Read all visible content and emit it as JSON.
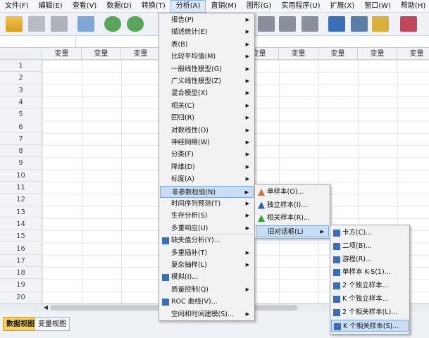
{
  "menubar": [
    "文件(F)",
    "编辑(E)",
    "查看(V)",
    "数据(D)",
    "转换(T)",
    "分析(A)",
    "直销(M)",
    "图形(G)",
    "实用程序(U)",
    "扩展(X)",
    "窗口(W)",
    "帮助(H)"
  ],
  "active_menu_index": 5,
  "grid": {
    "col_header": "变量",
    "rows": [
      "1",
      "2",
      "3",
      "4",
      "5",
      "6",
      "7",
      "8",
      "9",
      "10",
      "11",
      "12",
      "13",
      "14",
      "15",
      "16",
      "17",
      "18",
      "19",
      "20",
      "21"
    ]
  },
  "analyze_menu": [
    {
      "label": "报告(P)",
      "arrow": true
    },
    {
      "label": "描述统计(E)",
      "arrow": true
    },
    {
      "label": "表(B)",
      "arrow": true
    },
    {
      "label": "比较平均值(M)",
      "arrow": true
    },
    {
      "label": "一般线性模型(G)",
      "arrow": true
    },
    {
      "label": "广义线性模型(Z)",
      "arrow": true
    },
    {
      "label": "混合模型(X)",
      "arrow": true
    },
    {
      "label": "相关(C)",
      "arrow": true
    },
    {
      "label": "回归(R)",
      "arrow": true
    },
    {
      "label": "对数线性(O)",
      "arrow": true
    },
    {
      "label": "神经网络(W)",
      "arrow": true
    },
    {
      "label": "分类(F)",
      "arrow": true
    },
    {
      "label": "降维(D)",
      "arrow": true
    },
    {
      "label": "标度(A)",
      "arrow": true
    },
    {
      "label": "非参数检验(N)",
      "arrow": true,
      "highlight": true
    },
    {
      "label": "时间序列预测(T)",
      "arrow": true
    },
    {
      "label": "生存分析(S)",
      "arrow": true
    },
    {
      "label": "多重响应(U)",
      "arrow": true
    },
    {
      "label": "缺失值分析(Y)...",
      "arrow": false,
      "icon": true
    },
    {
      "label": "多重插补(T)",
      "arrow": true
    },
    {
      "label": "复杂抽样(L)",
      "arrow": true
    },
    {
      "label": "模拟(I)...",
      "arrow": false,
      "icon": true
    },
    {
      "label": "质量控制(Q)",
      "arrow": true
    },
    {
      "label": "ROC 曲线(V)...",
      "arrow": false,
      "icon": true
    },
    {
      "label": "空间和时间建模(S)...",
      "arrow": true
    }
  ],
  "nonparam_menu": [
    {
      "label": "单样本(O)...",
      "color": "#e07030"
    },
    {
      "label": "独立样本(I)...",
      "color": "#3060c0"
    },
    {
      "label": "相关样本(R)...",
      "color": "#30a040"
    },
    {
      "label": "旧对话框(L)",
      "arrow": true,
      "highlight": true
    }
  ],
  "legacy_menu": [
    {
      "label": "卡方(C)..."
    },
    {
      "label": "二项(B)..."
    },
    {
      "label": "游程(R)..."
    },
    {
      "label": "单样本 K-S(1)..."
    },
    {
      "label": "2 个独立样本..."
    },
    {
      "label": "K 个独立样本..."
    },
    {
      "label": "2 个相关样本(L)..."
    },
    {
      "label": "K 个相关样本(S)...",
      "highlight": true
    }
  ],
  "tabs": {
    "data_view": "数据视图",
    "variable_view": "变量视图"
  }
}
